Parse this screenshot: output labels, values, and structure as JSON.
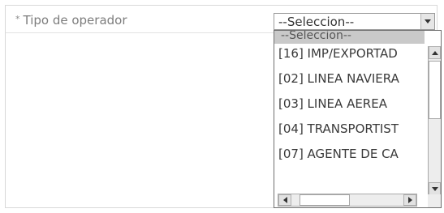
{
  "form": {
    "field_label": "Tipo de operador",
    "required_marker": "*",
    "select_value": "--Seleccion--"
  },
  "dropdown": {
    "options": [
      {
        "label": "--Seleccion--",
        "selected": true
      },
      {
        "label": "[16] IMP/EXPORTAD"
      },
      {
        "label": "[02] LINEA NAVIERA"
      },
      {
        "label": "[03] LINEA AEREA"
      },
      {
        "label": "[04] TRANSPORTIST"
      },
      {
        "label": "[07] AGENTE DE CA"
      }
    ]
  },
  "icons": {
    "select_arrow": "chevron-down-icon",
    "scroll_up": "scroll-up-arrow-icon",
    "scroll_down": "scroll-down-arrow-icon",
    "scroll_left": "scroll-left-arrow-icon",
    "scroll_right": "scroll-right-arrow-icon"
  },
  "colors": {
    "label_text": "#7d7d7d",
    "selected_option_bg": "#c9c9c9",
    "border": "#9a9a9a"
  }
}
